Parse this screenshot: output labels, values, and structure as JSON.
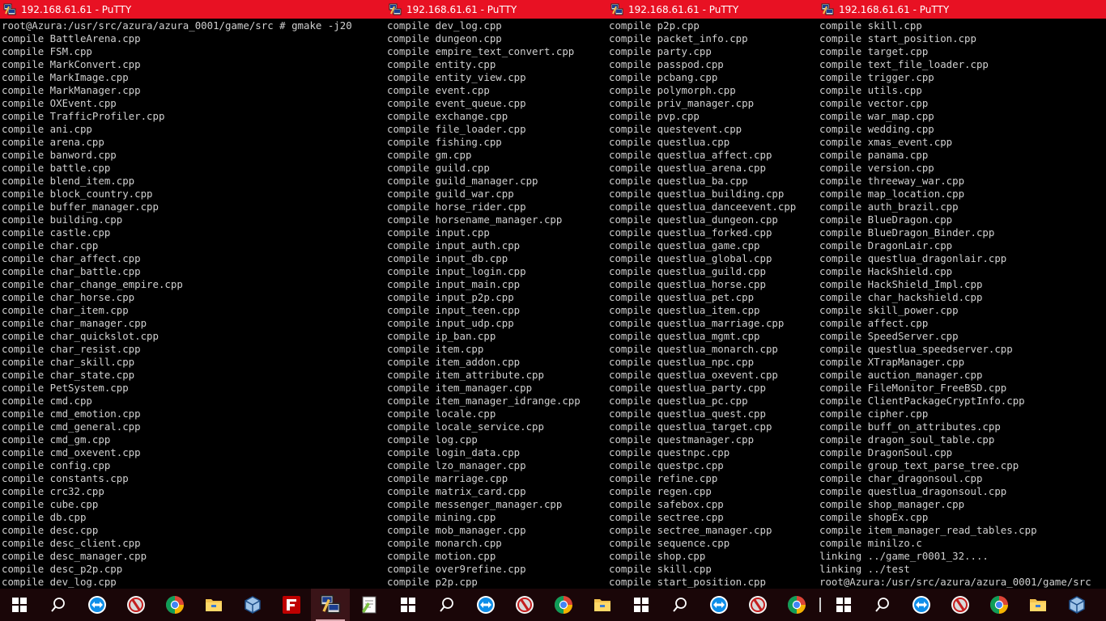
{
  "windows": [
    {
      "title": "192.168.61.61 - PuTTY",
      "lines": [
        "root@Azura:/usr/src/azura/azura_0001/game/src # gmake -j20",
        "compile BattleArena.cpp",
        "compile FSM.cpp",
        "compile MarkConvert.cpp",
        "compile MarkImage.cpp",
        "compile MarkManager.cpp",
        "compile OXEvent.cpp",
        "compile TrafficProfiler.cpp",
        "compile ani.cpp",
        "compile arena.cpp",
        "compile banword.cpp",
        "compile battle.cpp",
        "compile blend_item.cpp",
        "compile block_country.cpp",
        "compile buffer_manager.cpp",
        "compile building.cpp",
        "compile castle.cpp",
        "compile char.cpp",
        "compile char_affect.cpp",
        "compile char_battle.cpp",
        "compile char_change_empire.cpp",
        "compile char_horse.cpp",
        "compile char_item.cpp",
        "compile char_manager.cpp",
        "compile char_quickslot.cpp",
        "compile char_resist.cpp",
        "compile char_skill.cpp",
        "compile char_state.cpp",
        "compile PetSystem.cpp",
        "compile cmd.cpp",
        "compile cmd_emotion.cpp",
        "compile cmd_general.cpp",
        "compile cmd_gm.cpp",
        "compile cmd_oxevent.cpp",
        "compile config.cpp",
        "compile constants.cpp",
        "compile crc32.cpp",
        "compile cube.cpp",
        "compile db.cpp",
        "compile desc.cpp",
        "compile desc_client.cpp",
        "compile desc_manager.cpp",
        "compile desc_p2p.cpp",
        "compile dev_log.cpp"
      ]
    },
    {
      "title": "192.168.61.61 - PuTTY",
      "lines": [
        "compile dev_log.cpp",
        "compile dungeon.cpp",
        "compile empire_text_convert.cpp",
        "compile entity.cpp",
        "compile entity_view.cpp",
        "compile event.cpp",
        "compile event_queue.cpp",
        "compile exchange.cpp",
        "compile file_loader.cpp",
        "compile fishing.cpp",
        "compile gm.cpp",
        "compile guild.cpp",
        "compile guild_manager.cpp",
        "compile guild_war.cpp",
        "compile horse_rider.cpp",
        "compile horsename_manager.cpp",
        "compile input.cpp",
        "compile input_auth.cpp",
        "compile input_db.cpp",
        "compile input_login.cpp",
        "compile input_main.cpp",
        "compile input_p2p.cpp",
        "compile input_teen.cpp",
        "compile input_udp.cpp",
        "compile ip_ban.cpp",
        "compile item.cpp",
        "compile item_addon.cpp",
        "compile item_attribute.cpp",
        "compile item_manager.cpp",
        "compile item_manager_idrange.cpp",
        "compile locale.cpp",
        "compile locale_service.cpp",
        "compile log.cpp",
        "compile login_data.cpp",
        "compile lzo_manager.cpp",
        "compile marriage.cpp",
        "compile matrix_card.cpp",
        "compile messenger_manager.cpp",
        "compile mining.cpp",
        "compile mob_manager.cpp",
        "compile monarch.cpp",
        "compile motion.cpp",
        "compile over9refine.cpp",
        "compile p2p.cpp"
      ]
    },
    {
      "title": "192.168.61.61 - PuTTY",
      "lines": [
        "compile p2p.cpp",
        "compile packet_info.cpp",
        "compile party.cpp",
        "compile passpod.cpp",
        "compile pcbang.cpp",
        "compile polymorph.cpp",
        "compile priv_manager.cpp",
        "compile pvp.cpp",
        "compile questevent.cpp",
        "compile questlua.cpp",
        "compile questlua_affect.cpp",
        "compile questlua_arena.cpp",
        "compile questlua_ba.cpp",
        "compile questlua_building.cpp",
        "compile questlua_danceevent.cpp",
        "compile questlua_dungeon.cpp",
        "compile questlua_forked.cpp",
        "compile questlua_game.cpp",
        "compile questlua_global.cpp",
        "compile questlua_guild.cpp",
        "compile questlua_horse.cpp",
        "compile questlua_pet.cpp",
        "compile questlua_item.cpp",
        "compile questlua_marriage.cpp",
        "compile questlua_mgmt.cpp",
        "compile questlua_monarch.cpp",
        "compile questlua_npc.cpp",
        "compile questlua_oxevent.cpp",
        "compile questlua_party.cpp",
        "compile questlua_pc.cpp",
        "compile questlua_quest.cpp",
        "compile questlua_target.cpp",
        "compile questmanager.cpp",
        "compile questnpc.cpp",
        "compile questpc.cpp",
        "compile refine.cpp",
        "compile regen.cpp",
        "compile safebox.cpp",
        "compile sectree.cpp",
        "compile sectree_manager.cpp",
        "compile sequence.cpp",
        "compile shop.cpp",
        "compile skill.cpp",
        "compile start_position.cpp"
      ]
    },
    {
      "title": "192.168.61.61 - PuTTY",
      "lines": [
        "compile skill.cpp",
        "compile start_position.cpp",
        "compile target.cpp",
        "compile text_file_loader.cpp",
        "compile trigger.cpp",
        "compile utils.cpp",
        "compile vector.cpp",
        "compile war_map.cpp",
        "compile wedding.cpp",
        "compile xmas_event.cpp",
        "compile panama.cpp",
        "compile version.cpp",
        "compile threeway_war.cpp",
        "compile map_location.cpp",
        "compile auth_brazil.cpp",
        "compile BlueDragon.cpp",
        "compile BlueDragon_Binder.cpp",
        "compile DragonLair.cpp",
        "compile questlua_dragonlair.cpp",
        "compile HackShield.cpp",
        "compile HackShield_Impl.cpp",
        "compile char_hackshield.cpp",
        "compile skill_power.cpp",
        "compile affect.cpp",
        "compile SpeedServer.cpp",
        "compile questlua_speedserver.cpp",
        "compile XTrapManager.cpp",
        "compile auction_manager.cpp",
        "compile FileMonitor_FreeBSD.cpp",
        "compile ClientPackageCryptInfo.cpp",
        "compile cipher.cpp",
        "compile buff_on_attributes.cpp",
        "compile dragon_soul_table.cpp",
        "compile DragonSoul.cpp",
        "compile group_text_parse_tree.cpp",
        "compile char_dragonsoul.cpp",
        "compile questlua_dragonsoul.cpp",
        "compile shop_manager.cpp",
        "compile shopEx.cpp",
        "compile item_manager_read_tables.cpp",
        "compile minilzo.c",
        "linking ../game_r0001_32....",
        "linking ../test",
        "root@Azura:/usr/src/azura/azura_0001/game/src"
      ]
    }
  ],
  "taskbar": {
    "groups": [
      [
        "windows-start-icon",
        "search-icon",
        "teamviewer-icon",
        "app-red-icon",
        "chrome-icon",
        "file-explorer-icon",
        "virtualbox-icon",
        "filezilla-icon",
        "putty-icon",
        "notepad-plus-icon"
      ],
      [
        "windows-start-icon",
        "search-icon",
        "teamviewer-icon",
        "app-red-icon",
        "chrome-icon",
        "file-explorer-icon"
      ],
      [
        "windows-start-icon",
        "search-icon",
        "teamviewer-icon",
        "app-red-icon",
        "chrome-icon"
      ],
      [
        "windows-start-icon",
        "search-icon",
        "teamviewer-icon",
        "app-red-icon",
        "chrome-icon",
        "file-explorer-icon",
        "virtualbox-icon"
      ]
    ]
  }
}
